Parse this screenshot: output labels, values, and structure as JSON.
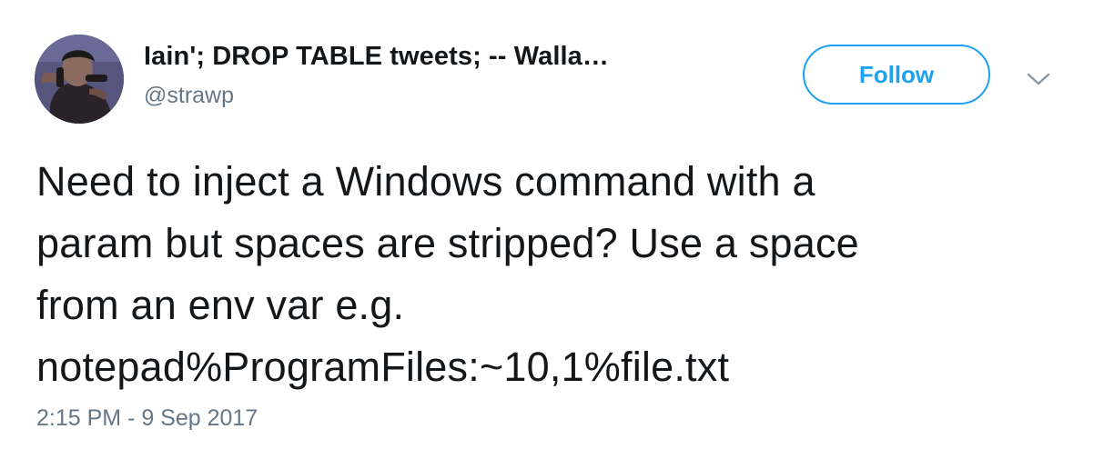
{
  "author": {
    "display_name": "Iain'; DROP TABLE tweets; -- Walla…",
    "handle": "@strawp"
  },
  "actions": {
    "follow_label": "Follow",
    "more_icon": "chevron-down-icon"
  },
  "tweet": {
    "lines": [
      "Need to inject a Windows command with a",
      "param but spaces are stripped? Use a space",
      "from an env var e.g.",
      "notepad%ProgramFiles:~10,1%file.txt"
    ],
    "timestamp": "2:15 PM - 9 Sep 2017"
  },
  "colors": {
    "accent": "#1da1f2",
    "text": "#14171a",
    "secondary_text": "#657786"
  }
}
